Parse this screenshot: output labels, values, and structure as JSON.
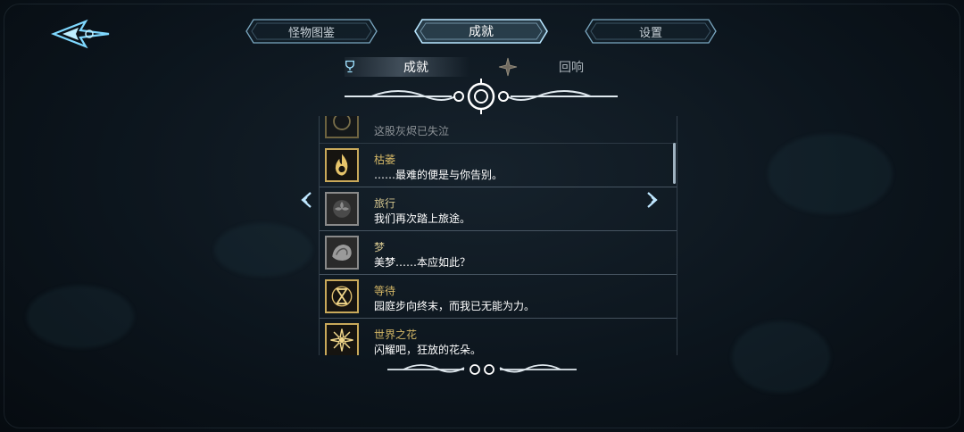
{
  "top_tabs": [
    {
      "label": "怪物图鉴",
      "active": false
    },
    {
      "label": "成就",
      "active": true
    },
    {
      "label": "设置",
      "active": false
    }
  ],
  "sub_tabs": [
    {
      "label": "成就",
      "active": true,
      "icon": "trophy-icon"
    },
    {
      "label": "回响",
      "active": false,
      "icon": "star-compass-icon"
    }
  ],
  "achievements": [
    {
      "title": "",
      "desc": "这股灰烬已失泣",
      "unlocked": true,
      "icon": "gold-emblem-icon"
    },
    {
      "title": "枯萎",
      "desc": "……最难的便是与你告别。",
      "unlocked": true,
      "icon": "flame-icon"
    },
    {
      "title": "旅行",
      "desc": "我们再次踏上旅途。",
      "unlocked": false,
      "icon": "flower-locked-icon"
    },
    {
      "title": "梦",
      "desc": "美梦……本应如此？",
      "unlocked": false,
      "icon": "shell-locked-icon"
    },
    {
      "title": "等待",
      "desc": "园庭步向终末，而我已无能为力。",
      "unlocked": true,
      "icon": "hourglass-icon"
    },
    {
      "title": "世界之花",
      "desc": "闪耀吧，狂放的花朵。",
      "unlocked": true,
      "icon": "sunflower-icon"
    }
  ],
  "colors": {
    "background": "#0c151d",
    "gold": "#c9a95a",
    "title_gold": "#d4b766",
    "accent_blue": "#6fd0ff"
  }
}
